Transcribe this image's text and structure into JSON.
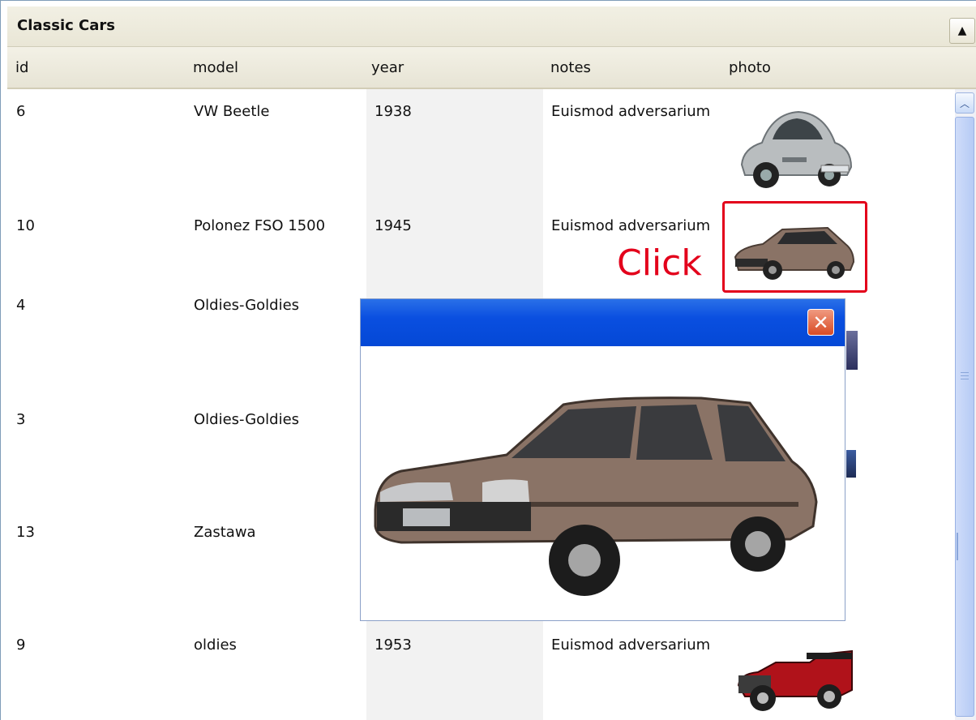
{
  "panel": {
    "title": "Classic Cars",
    "collapse_icon": "triangle-up-icon"
  },
  "table": {
    "columns": [
      "id",
      "model",
      "year",
      "notes",
      "photo"
    ],
    "rows": [
      {
        "id": "6",
        "model": "VW Beetle",
        "year": "1938",
        "notes": "Euismod adversarium",
        "photo": "beetle"
      },
      {
        "id": "10",
        "model": "Polonez FSO 1500",
        "year": "1945",
        "notes": "Euismod adversarium",
        "photo": "polonez"
      },
      {
        "id": "4",
        "model": "Oldies-Goldies",
        "year": "",
        "notes": "",
        "photo": ""
      },
      {
        "id": "3",
        "model": "Oldies-Goldies",
        "year": "",
        "notes": "",
        "photo": ""
      },
      {
        "id": "13",
        "model": "Zastawa",
        "year": "",
        "notes": "",
        "photo": ""
      },
      {
        "id": "9",
        "model": "oldies",
        "year": "1953",
        "notes": "Euismod adversarium",
        "photo": "roadster"
      }
    ]
  },
  "annotation": {
    "label": "Click",
    "color": "#e3001b"
  },
  "popup": {
    "close_icon": "close-x-icon",
    "title_bar_color": "#0a4fe0"
  },
  "colors": {
    "header_bg": "#ece9d8",
    "year_column_bg": "#f2f2f2",
    "car_brown": "#8a7366",
    "beetle_gray": "#b9bdbf",
    "roadster_red": "#b0121a"
  }
}
